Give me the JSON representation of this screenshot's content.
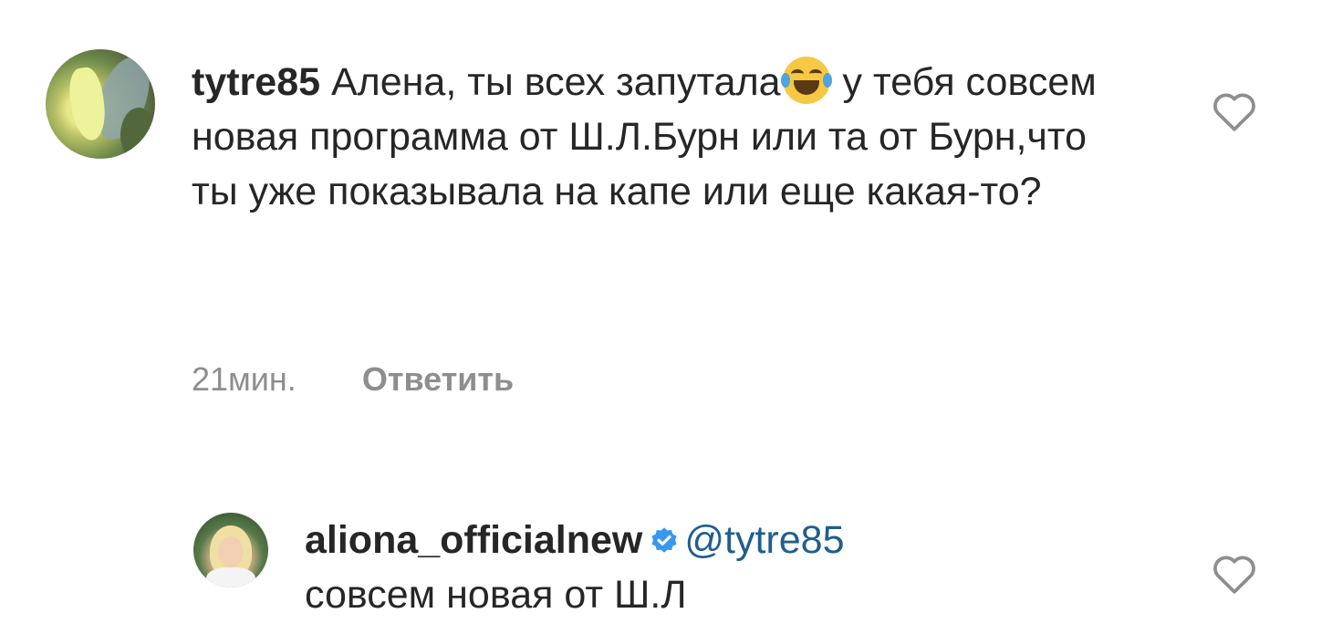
{
  "comment": {
    "username": "tytre85",
    "text_before_emoji": "Алена, ты всех запутала",
    "emoji": "face-with-tears-of-joy",
    "text_after_emoji": " у тебя совсем новая программа от Ш.Л.Бурн или та от Бурн,что ты уже показывала на  капе или еще какая-то?",
    "time": "21мин.",
    "reply_label": "Ответить"
  },
  "reply": {
    "username": "aliona_officialnew",
    "verified": true,
    "mention": "@tytre85",
    "text": "совсем новая от Ш.Л"
  },
  "icons": {
    "like": "heart-outline-icon",
    "verified": "verified-badge-icon"
  },
  "colors": {
    "text": "#262626",
    "meta": "#8e8e8e",
    "mention": "#1f5e8f",
    "verified": "#3897f0"
  }
}
